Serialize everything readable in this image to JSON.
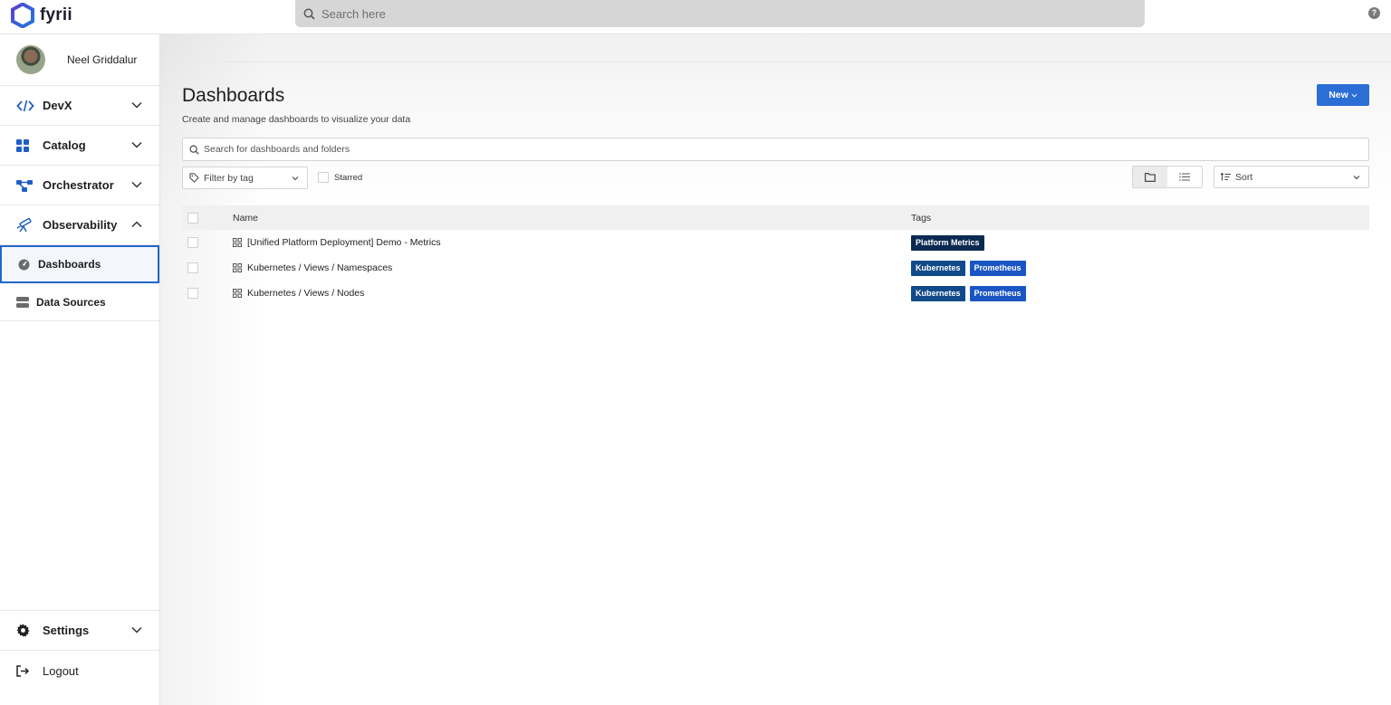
{
  "app": {
    "name": "fyrii"
  },
  "topbar": {
    "search_placeholder": "Search here",
    "help_label": "?"
  },
  "user": {
    "name": "Neel Griddalur"
  },
  "sidebar": {
    "items": [
      {
        "label": "DevX"
      },
      {
        "label": "Catalog"
      },
      {
        "label": "Orchestrator"
      },
      {
        "label": "Observability"
      }
    ],
    "subitems": [
      {
        "label": "Dashboards"
      },
      {
        "label": "Data Sources"
      }
    ],
    "settings_label": "Settings",
    "logout_label": "Logout"
  },
  "page": {
    "title": "Dashboards",
    "subtitle": "Create and manage dashboards to visualize your data",
    "new_label": "New",
    "search_placeholder": "Search for dashboards and folders",
    "filter_label": "Filter by tag",
    "starred_label": "Starred",
    "sort_label": "Sort"
  },
  "table": {
    "headers": {
      "name": "Name",
      "tags": "Tags"
    },
    "rows": [
      {
        "name": "[Unified Platform Deployment] Demo - Metrics",
        "tags": [
          "Platform Metrics"
        ]
      },
      {
        "name": "Kubernetes / Views / Namespaces",
        "tags": [
          "Kubernetes",
          "Prometheus"
        ]
      },
      {
        "name": "Kubernetes / Views / Nodes",
        "tags": [
          "Kubernetes",
          "Prometheus"
        ]
      }
    ]
  },
  "colors": {
    "accent": "#2b6fd6",
    "tag_platform_metrics": "#0b2a52",
    "tag_kubernetes": "#114a8a",
    "tag_prometheus": "#1b55c4"
  }
}
